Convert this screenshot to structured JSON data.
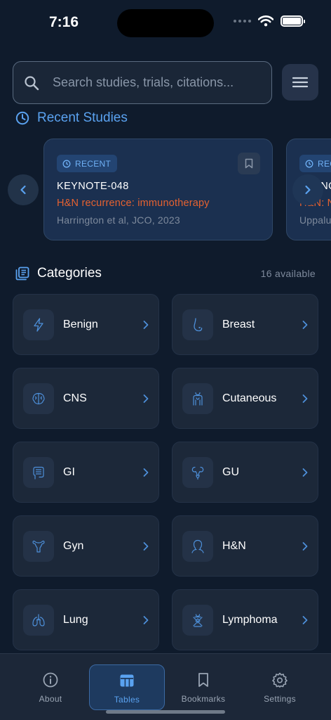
{
  "status_bar": {
    "time": "7:16"
  },
  "search": {
    "placeholder": "Search studies, trials, citations..."
  },
  "recent": {
    "title": "Recent Studies",
    "cards": [
      {
        "badge": "RECENT",
        "title": "KEYNOTE-048",
        "subtitle": "H&N recurrence: immunotherapy",
        "citation": "Harrington et al, JCO, 2023"
      },
      {
        "badge": "REC",
        "title": "KEYNO",
        "subtitle": "H&N: N",
        "citation": "Uppalu"
      }
    ]
  },
  "categories": {
    "title": "Categories",
    "count": "16 available",
    "items": [
      {
        "label": "Benign",
        "icon": "lightning-icon"
      },
      {
        "label": "Breast",
        "icon": "breast-icon"
      },
      {
        "label": "CNS",
        "icon": "brain-icon"
      },
      {
        "label": "Cutaneous",
        "icon": "body-icon"
      },
      {
        "label": "GI",
        "icon": "intestine-icon"
      },
      {
        "label": "GU",
        "icon": "kidney-icon"
      },
      {
        "label": "Gyn",
        "icon": "uterus-icon"
      },
      {
        "label": "H&N",
        "icon": "head-icon"
      },
      {
        "label": "Lung",
        "icon": "lungs-icon"
      },
      {
        "label": "Lymphoma",
        "icon": "lymph-icon"
      }
    ]
  },
  "tabs": [
    {
      "label": "About",
      "icon": "info-icon"
    },
    {
      "label": "Tables",
      "icon": "table-icon",
      "active": true
    },
    {
      "label": "Bookmarks",
      "icon": "bookmark-icon"
    },
    {
      "label": "Settings",
      "icon": "gear-icon"
    }
  ],
  "colors": {
    "accent": "#5aa2f0",
    "highlight": "#e66230",
    "background": "#0f1b2c"
  }
}
